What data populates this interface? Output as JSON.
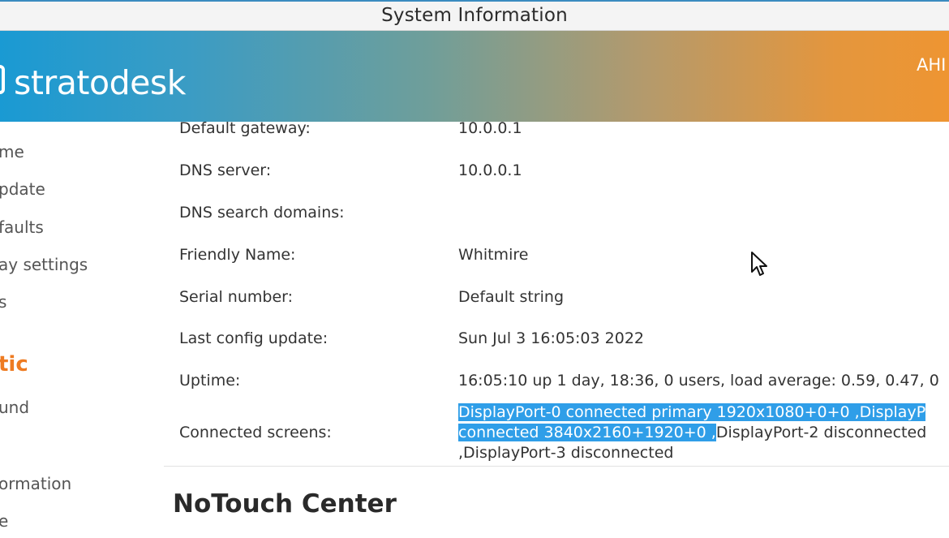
{
  "window": {
    "title": "System Information"
  },
  "banner": {
    "logo_text": "stratodesk",
    "user_text": "AHI",
    "logo_icon": "stratodesk-logo-icon"
  },
  "sidebar": {
    "items": [
      {
        "label": "me"
      },
      {
        "label": "pdate"
      },
      {
        "label": "faults"
      },
      {
        "label": "ay settings"
      },
      {
        "label": "s"
      }
    ],
    "heading": "tic",
    "items_after": [
      {
        "label": "und"
      },
      {
        "label": "ormation"
      },
      {
        "label": "e"
      }
    ]
  },
  "info": {
    "rows": [
      {
        "label": "Default gateway:",
        "value": "10.0.0.1"
      },
      {
        "label": "DNS server:",
        "value": "10.0.0.1"
      },
      {
        "label": "DNS search domains:",
        "value": ""
      },
      {
        "label": "Friendly Name:",
        "value": "Whitmire"
      },
      {
        "label": "Serial number:",
        "value": "Default string"
      },
      {
        "label": "Last config update:",
        "value": "Sun Jul 3 16:05:03 2022"
      },
      {
        "label": "Uptime:",
        "value": "16:05:10 up 1 day, 18:36, 0 users, load average: 0.59, 0.47, 0"
      }
    ],
    "connected_screens": {
      "label": "Connected screens:",
      "line1_selected": "DisplayPort-0 connected primary 1920x1080+0+0 ,DisplayP",
      "line2_selected": "connected 3840x2160+1920+0 ,",
      "line2_rest": "DisplayPort-2 disconnected",
      "line3": ",DisplayPort-3 disconnected"
    }
  },
  "section": {
    "title": "NoTouch Center"
  },
  "colors": {
    "banner_start": "#1a9ad3",
    "banner_end": "#ee9532",
    "accent_orange": "#ee7b22",
    "selection": "#2f9ee8"
  },
  "icons": {
    "cursor": "mouse-pointer-icon"
  }
}
